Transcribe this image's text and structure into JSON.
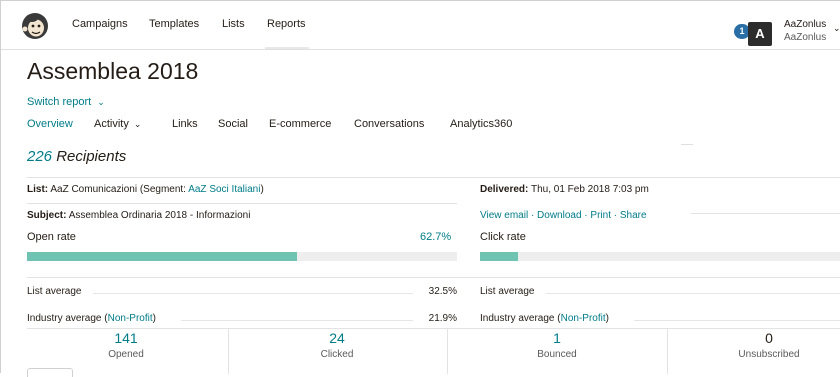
{
  "nav": {
    "items": [
      "Campaigns",
      "Templates",
      "Lists",
      "Reports"
    ]
  },
  "account": {
    "notification_count": "1",
    "avatar_letter": "A",
    "name": "AaZonlus",
    "subname": "AaZonlus"
  },
  "report": {
    "title": "Assemblea 2018",
    "switch_label": "Switch report",
    "tabs": [
      {
        "label": "Overview",
        "active": true
      },
      {
        "label": "Activity",
        "dropdown": true
      },
      {
        "label": "Links"
      },
      {
        "label": "Social"
      },
      {
        "label": "E-commerce"
      },
      {
        "label": "Conversations"
      },
      {
        "label": "Analytics360"
      }
    ],
    "recipients_count": "226",
    "recipients_label": "Recipients"
  },
  "details": {
    "list_label": "List:",
    "list_value": "AaZ Comunicazioni (Segment:",
    "segment_name": "AaZ Soci Italiani",
    "segment_close": ")",
    "subject_label": "Subject:",
    "subject_value": "Assemblea Ordinaria 2018 - Informazioni",
    "delivered_label": "Delivered:",
    "delivered_value": "Thu, 01 Feb 2018 7:03 pm",
    "actions": "View email · Download · Print · Share"
  },
  "open": {
    "label": "Open rate",
    "value": "62.7%",
    "fill": 0.627,
    "list_avg_label": "List average",
    "list_avg_value": "32.5%",
    "industry_label": "Industry average (",
    "industry_link": "Non-Profit",
    "industry_close": ")",
    "industry_value": "21.9%"
  },
  "click": {
    "label": "Click rate",
    "fill": 0.106,
    "list_avg_label": "List average",
    "industry_label": "Industry average (",
    "industry_link": "Non-Profit",
    "industry_close": ")"
  },
  "stats": [
    {
      "value": "141",
      "label": "Opened"
    },
    {
      "value": "24",
      "label": "Clicked"
    },
    {
      "value": "1",
      "label": "Bounced"
    },
    {
      "value": "0",
      "label": "Unsubscribed"
    }
  ],
  "colors": {
    "accent": "#007c89",
    "bar_fill": "#6fc3b3",
    "notification": "#2a6ea6"
  }
}
